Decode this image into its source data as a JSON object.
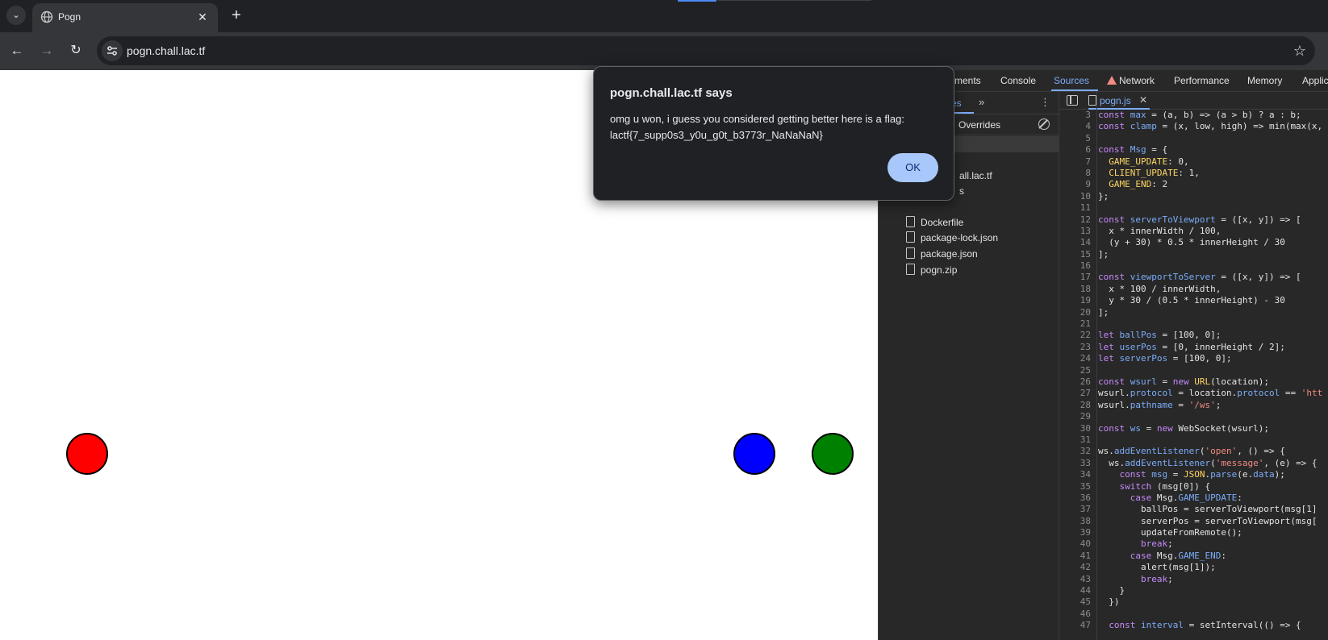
{
  "browser": {
    "tab": {
      "title": "Pogn",
      "close_glyph": "✕"
    },
    "new_tab_glyph": "+",
    "tab_search_glyph": "⌄",
    "nav": {
      "back": "←",
      "forward": "→",
      "reload": "↻",
      "star": "☆"
    },
    "url": "pogn.chall.lac.tf"
  },
  "dialog": {
    "title": "pogn.chall.lac.tf says",
    "message": "omg u won, i guess you considered getting better here is a flag:",
    "flag": "lactf{7_supp0s3_y0u_g0t_b3773r_NaNaNaN}",
    "ok_label": "OK"
  },
  "game": {
    "balls": [
      {
        "name": "red",
        "color": "#ff0000"
      },
      {
        "name": "blue",
        "color": "#0000ff"
      },
      {
        "name": "green",
        "color": "#008000"
      }
    ]
  },
  "devtools": {
    "tabs": [
      "ments",
      "Console",
      "Sources",
      "Network",
      "Performance",
      "Memory",
      "Applic"
    ],
    "active_tab": "Sources",
    "navigator": {
      "files_tab": "es",
      "more_glyph": "»",
      "menu_glyph": "⋮",
      "overrides_tab": "Overrides",
      "tree_host": "all.lac.tf",
      "tree_folder": "s",
      "files": [
        "Dockerfile",
        "package-lock.json",
        "package.json",
        "pogn.zip"
      ]
    },
    "editor": {
      "file_name": "pogn.js",
      "close_glyph": "✕",
      "lines": [
        {
          "n": "3",
          "c": "const max = (a, b) => (a > b) ? a : b;"
        },
        {
          "n": "4",
          "c": "const clamp = (x, low, high) => min(max(x,"
        },
        {
          "n": "5",
          "c": ""
        },
        {
          "n": "6",
          "c": "const Msg = {"
        },
        {
          "n": "7",
          "c": "  GAME_UPDATE: 0,"
        },
        {
          "n": "8",
          "c": "  CLIENT_UPDATE: 1,"
        },
        {
          "n": "9",
          "c": "  GAME_END: 2"
        },
        {
          "n": "10",
          "c": "};"
        },
        {
          "n": "11",
          "c": ""
        },
        {
          "n": "12",
          "c": "const serverToViewport = ([x, y]) => ["
        },
        {
          "n": "13",
          "c": "  x * innerWidth / 100,"
        },
        {
          "n": "14",
          "c": "  (y + 30) * 0.5 * innerHeight / 30"
        },
        {
          "n": "15",
          "c": "];"
        },
        {
          "n": "16",
          "c": ""
        },
        {
          "n": "17",
          "c": "const viewportToServer = ([x, y]) => ["
        },
        {
          "n": "18",
          "c": "  x * 100 / innerWidth,"
        },
        {
          "n": "19",
          "c": "  y * 30 / (0.5 * innerHeight) - 30"
        },
        {
          "n": "20",
          "c": "];"
        },
        {
          "n": "21",
          "c": ""
        },
        {
          "n": "22",
          "c": "let ballPos = [100, 0];"
        },
        {
          "n": "23",
          "c": "let userPos = [0, innerHeight / 2];"
        },
        {
          "n": "24",
          "c": "let serverPos = [100, 0];"
        },
        {
          "n": "25",
          "c": ""
        },
        {
          "n": "26",
          "c": "const wsurl = new URL(location);"
        },
        {
          "n": "27",
          "c": "wsurl.protocol = location.protocol == 'htt"
        },
        {
          "n": "28",
          "c": "wsurl.pathname = '/ws';"
        },
        {
          "n": "29",
          "c": ""
        },
        {
          "n": "30",
          "c": "const ws = new WebSocket(wsurl);"
        },
        {
          "n": "31",
          "c": ""
        },
        {
          "n": "32",
          "c": "ws.addEventListener('open', () => {"
        },
        {
          "n": "33",
          "c": "  ws.addEventListener('message', (e) => {"
        },
        {
          "n": "34",
          "c": "    const msg = JSON.parse(e.data);"
        },
        {
          "n": "35",
          "c": "    switch (msg[0]) {"
        },
        {
          "n": "36",
          "c": "      case Msg.GAME_UPDATE:"
        },
        {
          "n": "37",
          "c": "        ballPos = serverToViewport(msg[1]"
        },
        {
          "n": "38",
          "c": "        serverPos = serverToViewport(msg["
        },
        {
          "n": "39",
          "c": "        updateFromRemote();"
        },
        {
          "n": "40",
          "c": "        break;"
        },
        {
          "n": "41",
          "c": "      case Msg.GAME_END:"
        },
        {
          "n": "42",
          "c": "        alert(msg[1]);"
        },
        {
          "n": "43",
          "c": "        break;"
        },
        {
          "n": "44",
          "c": "    }"
        },
        {
          "n": "45",
          "c": "  })"
        },
        {
          "n": "46",
          "c": ""
        },
        {
          "n": "47",
          "c": "  const interval = setInterval(() => {"
        }
      ]
    }
  }
}
